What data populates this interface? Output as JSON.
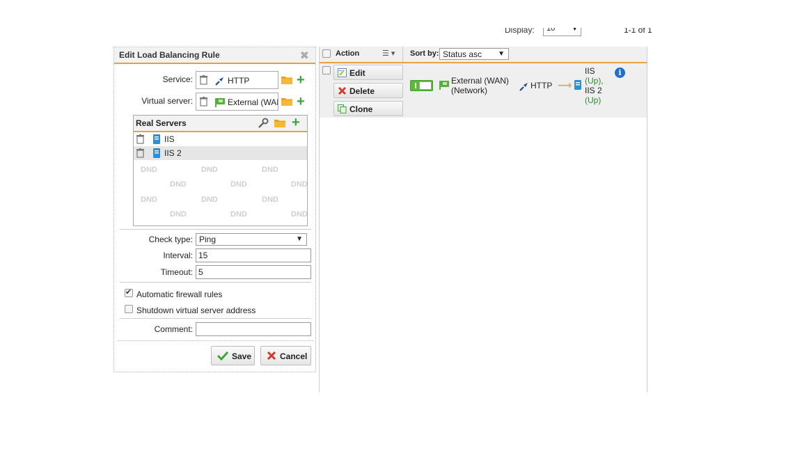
{
  "top_bar": {
    "display_label": "Display:",
    "display_value": "10",
    "page_info": "1-1 of 1"
  },
  "edit_panel": {
    "title": "Edit Load Balancing Rule",
    "service_label": "Service:",
    "service_value": "HTTP",
    "virtual_server_label": "Virtual server:",
    "virtual_server_value": "External (WAN)",
    "real_servers": {
      "title": "Real Servers",
      "items": [
        "IIS",
        "IIS 2"
      ],
      "dnd_text": "DND"
    },
    "check_type_label": "Check type:",
    "check_type_value": "Ping",
    "interval_label": "Interval:",
    "interval_value": "15",
    "timeout_label": "Timeout:",
    "timeout_value": "5",
    "auto_firewall_label": "Automatic firewall rules",
    "auto_firewall_checked": true,
    "shutdown_label": "Shutdown virtual server address",
    "shutdown_checked": false,
    "comment_label": "Comment:",
    "comment_value": "",
    "save_label": "Save",
    "cancel_label": "Cancel"
  },
  "list_panel": {
    "action_header": "Action",
    "sort_label": "Sort by:",
    "sort_value": "Status asc",
    "row": {
      "edit_label": "Edit",
      "delete_label": "Delete",
      "clone_label": "Clone",
      "enabled": true,
      "interface_line1": "External (WAN)",
      "interface_line2": "(Network)",
      "service": "HTTP",
      "server1": "IIS",
      "server1_status": "(Up),",
      "server2": "IIS 2",
      "server2_status": "(Up)"
    }
  },
  "colors": {
    "accent_orange": "#e8a040",
    "green": "#3ba53b",
    "up_green": "#2c8a2c",
    "info_blue": "#1e6fd0"
  }
}
